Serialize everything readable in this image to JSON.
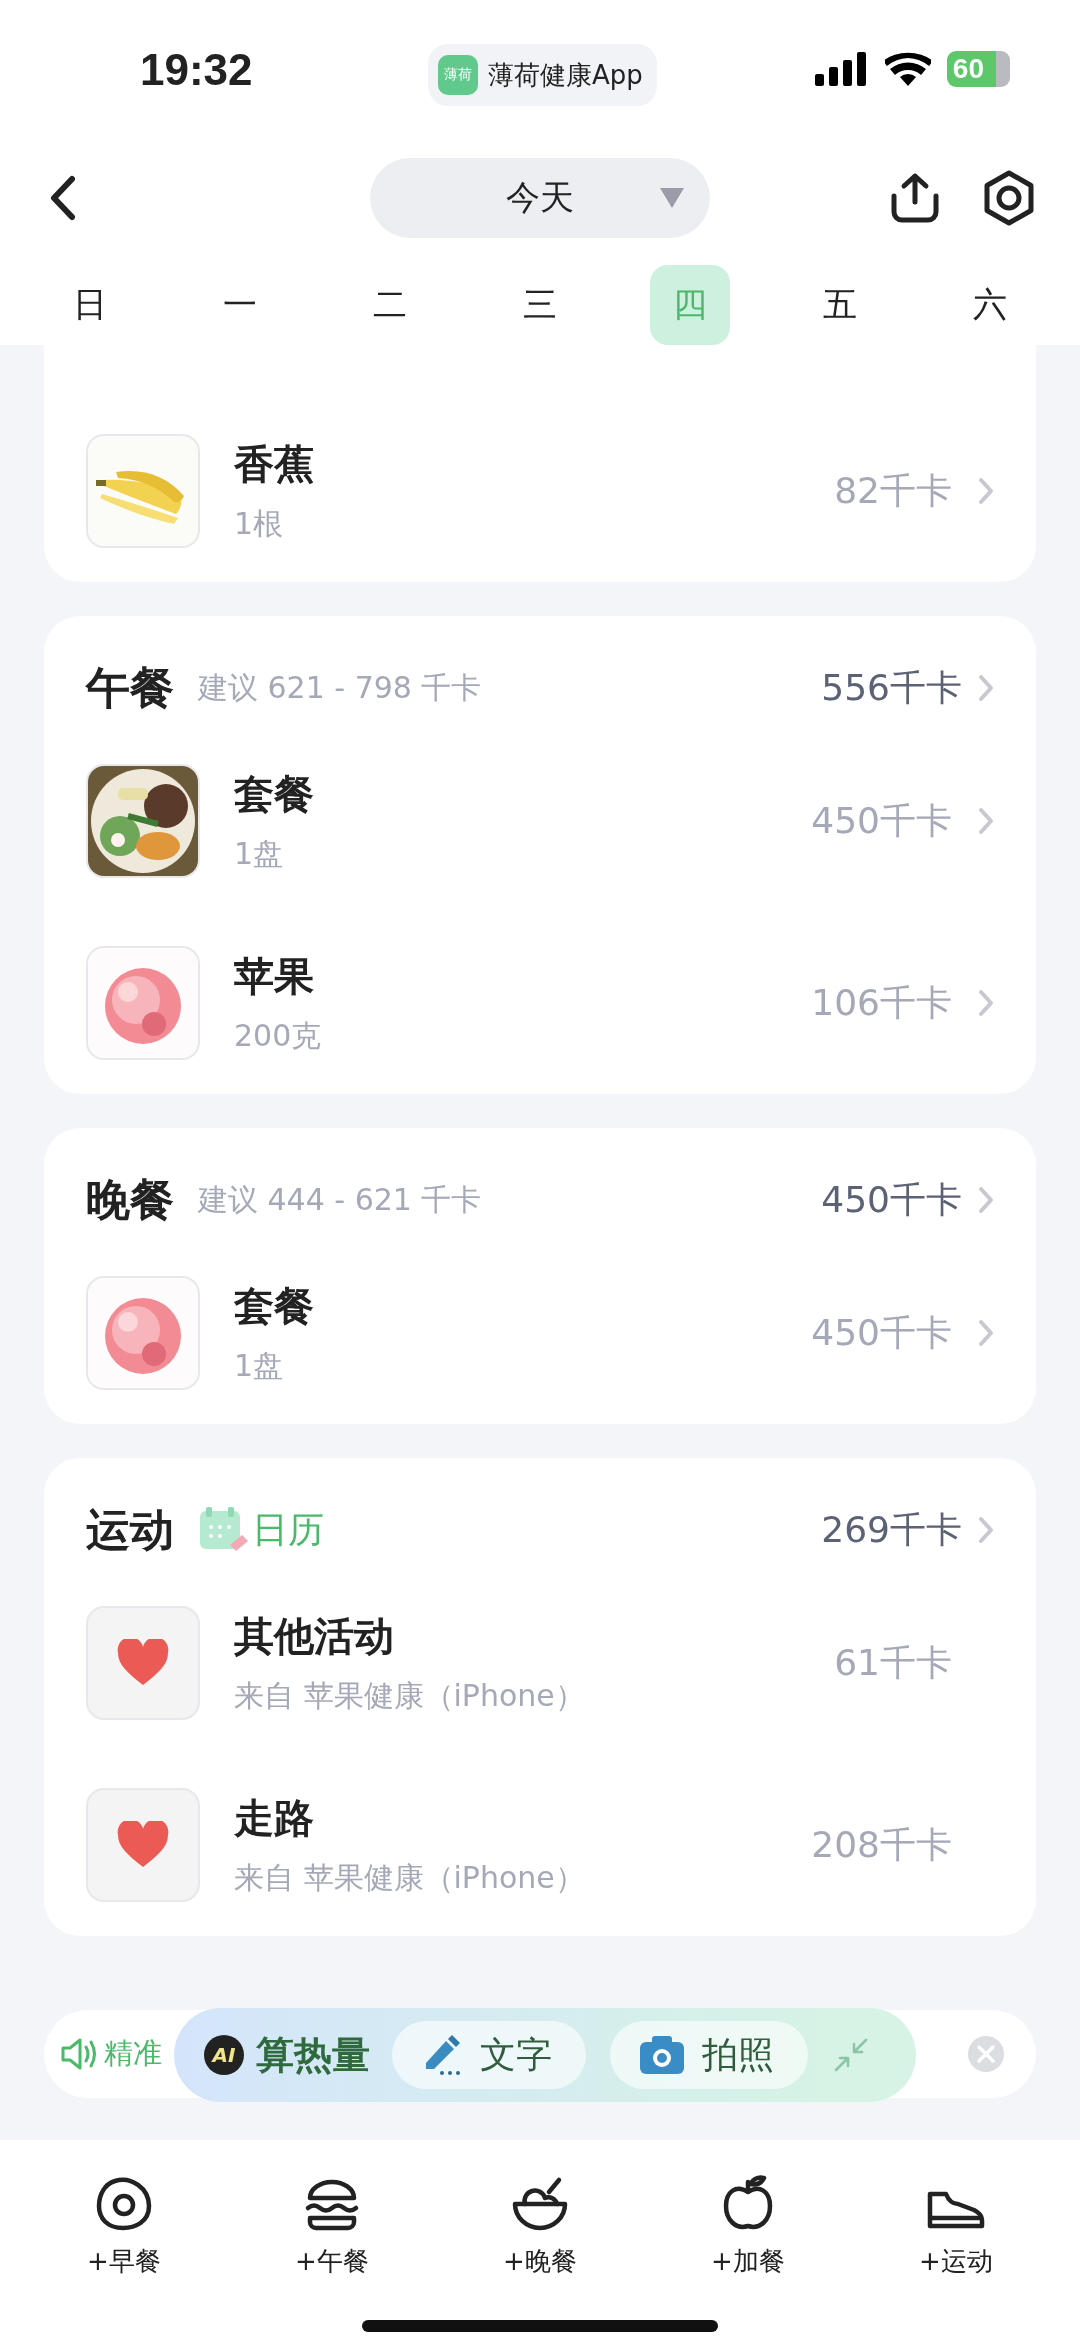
{
  "status_bar": {
    "time": "19:32",
    "app_icon_text": "薄荷",
    "app_name": "薄荷健康App",
    "battery": "60"
  },
  "nav": {
    "date": "今天"
  },
  "weekdays": [
    {
      "label": "日",
      "selected": false
    },
    {
      "label": "一",
      "selected": false
    },
    {
      "label": "二",
      "selected": false
    },
    {
      "label": "三",
      "selected": false
    },
    {
      "label": "四",
      "selected": true
    },
    {
      "label": "五",
      "selected": false
    },
    {
      "label": "六",
      "selected": false
    }
  ],
  "sections": [
    {
      "items": [
        {
          "kind": "food",
          "name": "香蕉",
          "amount": "1根",
          "calories": "82千卡"
        }
      ]
    },
    {
      "title": "午餐",
      "hint": "建议 621 - 798 千卡",
      "total": "556千卡",
      "items": [
        {
          "kind": "food",
          "name": "套餐",
          "amount": "1盘",
          "calories": "450千卡"
        },
        {
          "kind": "food",
          "name": "苹果",
          "amount": "200克",
          "calories": "106千卡"
        }
      ]
    },
    {
      "title": "晚餐",
      "hint": "建议 444 - 621 千卡",
      "total": "450千卡",
      "items": [
        {
          "kind": "food",
          "name": "套餐",
          "amount": "1盘",
          "calories": "450千卡"
        }
      ]
    },
    {
      "title": "运动",
      "tag": "日历",
      "total": "269千卡",
      "items": [
        {
          "kind": "activity",
          "name": "其他活动",
          "amount": "来自 苹果健康（iPhone）",
          "calories": "61千卡"
        },
        {
          "kind": "activity",
          "name": "走路",
          "amount": "来自 苹果健康（iPhone）",
          "calories": "208千卡"
        }
      ]
    }
  ],
  "ai_bar": {
    "hint": "精准",
    "badge": "AI",
    "title": "算热量",
    "actions": [
      {
        "kind": "text",
        "label": "文字"
      },
      {
        "label": "拍照"
      }
    ]
  },
  "bottom_tabs": [
    {
      "kind": "breakfast",
      "label": "+早餐"
    },
    {
      "kind": "lunch",
      "label": "+午餐"
    },
    {
      "kind": "dinner",
      "label": "+晚餐"
    },
    {
      "kind": "snack",
      "label": "+加餐"
    },
    {
      "kind": "sport",
      "label": "+运动"
    }
  ]
}
